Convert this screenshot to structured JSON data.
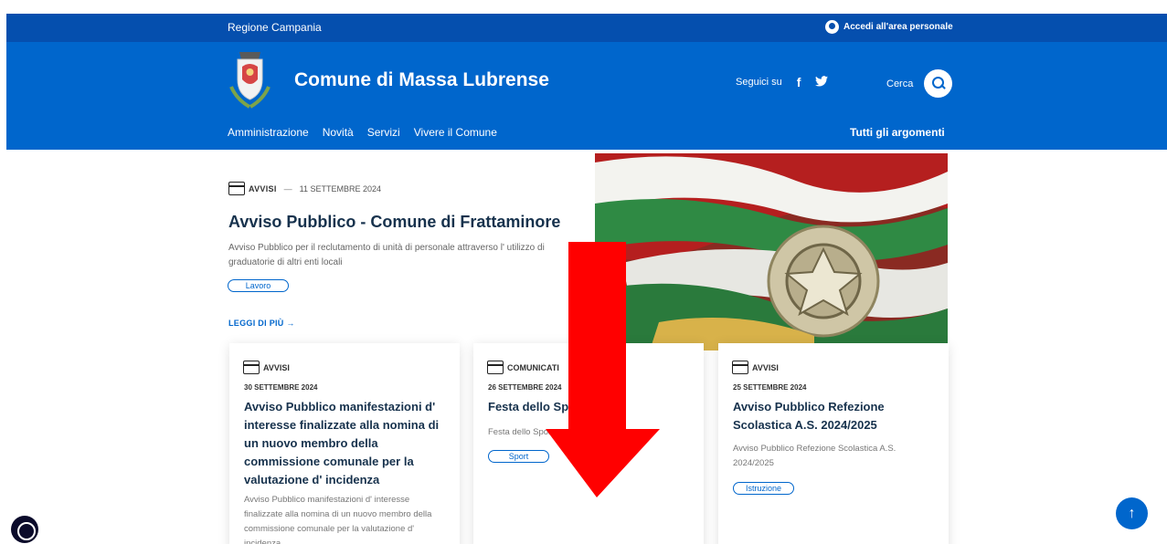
{
  "topbar": {
    "region": "Regione Campania",
    "login_label": "Accedi all'area personale"
  },
  "header": {
    "site_title": "Comune di Massa Lubrense",
    "social_label": "Seguici su",
    "facebook_icon": "f",
    "twitter_icon": "🐦",
    "search_label": "Cerca"
  },
  "nav": {
    "items": [
      "Amministrazione",
      "Novità",
      "Servizi",
      "Vivere il Comune"
    ],
    "topics": "Tutti gli argomenti"
  },
  "hero": {
    "category": "AVVISI",
    "separator": "—",
    "date": "11 SETTEMBRE 2024",
    "title": "Avviso Pubblico - Comune di Frattaminore",
    "description": "Avviso Pubblico per il reclutamento di unità di personale attraverso l' utilizzo di graduatorie di altri enti locali",
    "tag": "Lavoro",
    "read_more": "LEGGI DI PIÙ →"
  },
  "cards": [
    {
      "category": "AVVISI",
      "date": "30 SETTEMBRE 2024",
      "title": "Avviso Pubblico manifestazioni d' interesse finalizzate alla nomina di un nuovo membro della commissione comunale per la valutazione d' incidenza",
      "description": "Avviso Pubblico manifestazioni d' interesse finalizzate alla nomina di un nuovo membro della commissione comunale per la valutazione d' incidenza"
    },
    {
      "category": "COMUNICATI",
      "date": "26 SETTEMBRE 2024",
      "title": "Festa dello Sport",
      "description": "Festa dello Sport",
      "tag": "Sport"
    },
    {
      "category": "AVVISI",
      "date": "25 SETTEMBRE 2024",
      "title": "Avviso Pubblico Refezione Scolastica A.S. 2024/2025",
      "description": "Avviso Pubblico Refezione Scolastica A.S. 2024/2025",
      "tag": "Istruzione"
    }
  ],
  "floating": {
    "back_to_top": "↑"
  },
  "colors": {
    "primary": "#0066cc",
    "topbar": "#054fae",
    "title": "#17324d",
    "arrow": "#ff0000"
  }
}
